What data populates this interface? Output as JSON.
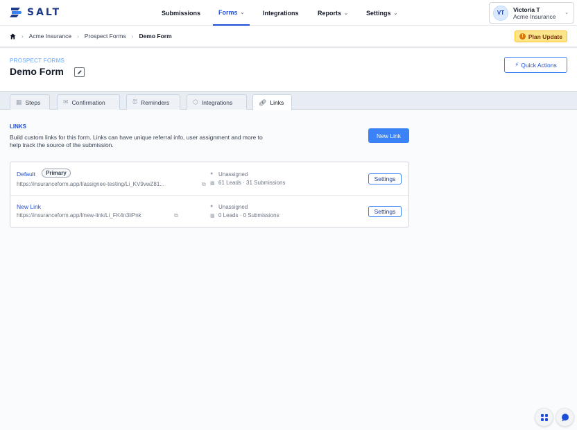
{
  "app": {
    "logo_text": "SALT"
  },
  "nav": {
    "items": [
      {
        "label": "Submissions",
        "has_menu": false
      },
      {
        "label": "Forms",
        "has_menu": true,
        "active": true
      },
      {
        "label": "Integrations",
        "has_menu": false
      },
      {
        "label": "Reports",
        "has_menu": true
      },
      {
        "label": "Settings",
        "has_menu": true
      }
    ]
  },
  "user": {
    "initials": "VT",
    "name": "Victoria T",
    "org": "Acme Insurance"
  },
  "breadcrumb": {
    "items": [
      "Acme Insurance",
      "Prospect Forms"
    ],
    "current": "Demo Form"
  },
  "plan_update": {
    "label": "Plan Update"
  },
  "header": {
    "kicker": "PROSPECT FORMS",
    "title": "Demo Form",
    "quick_actions": "Quick Actions"
  },
  "tabs": [
    {
      "label": "Steps",
      "icon": "grid-icon"
    },
    {
      "label": "Confirmation",
      "icon": "envelope-icon"
    },
    {
      "label": "Reminders",
      "icon": "alarm-clock-icon"
    },
    {
      "label": "Integrations",
      "icon": "cube-icon"
    },
    {
      "label": "Links",
      "icon": "link-icon",
      "active": true
    }
  ],
  "links_section": {
    "title": "LINKS",
    "description": "Build custom links for this form. Links can have unique referral info, user assignment and more to help track the source of the submission.",
    "new_link_label": "New Link"
  },
  "links": [
    {
      "name": "Default",
      "badge": "Primary",
      "url": "https://insuranceform.app/l/assignee-testing/Li_KV9vwZ81...",
      "assignee": "Unassigned",
      "stats": "61 Leads · 31 Submissions",
      "settings_label": "Settings"
    },
    {
      "name": "New Link",
      "badge": "",
      "url": "https://insuranceform.app/l/new-link/Li_FK4n3liPnk",
      "assignee": "Unassigned",
      "stats": "0 Leads · 0 Submissions",
      "settings_label": "Settings"
    }
  ],
  "colors": {
    "accent": "#3b82f6",
    "brand": "#1e3a8a",
    "warning": "#fde68a"
  }
}
